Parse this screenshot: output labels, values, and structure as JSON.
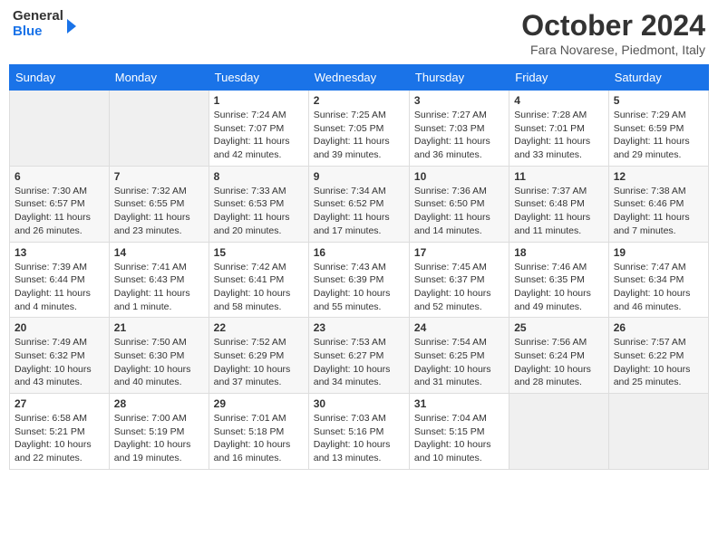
{
  "logo": {
    "line1": "General",
    "line2": "Blue"
  },
  "header": {
    "title": "October 2024",
    "subtitle": "Fara Novarese, Piedmont, Italy"
  },
  "weekdays": [
    "Sunday",
    "Monday",
    "Tuesday",
    "Wednesday",
    "Thursday",
    "Friday",
    "Saturday"
  ],
  "weeks": [
    [
      {
        "day": "",
        "sunrise": "",
        "sunset": "",
        "daylight": ""
      },
      {
        "day": "",
        "sunrise": "",
        "sunset": "",
        "daylight": ""
      },
      {
        "day": "1",
        "sunrise": "Sunrise: 7:24 AM",
        "sunset": "Sunset: 7:07 PM",
        "daylight": "Daylight: 11 hours and 42 minutes."
      },
      {
        "day": "2",
        "sunrise": "Sunrise: 7:25 AM",
        "sunset": "Sunset: 7:05 PM",
        "daylight": "Daylight: 11 hours and 39 minutes."
      },
      {
        "day": "3",
        "sunrise": "Sunrise: 7:27 AM",
        "sunset": "Sunset: 7:03 PM",
        "daylight": "Daylight: 11 hours and 36 minutes."
      },
      {
        "day": "4",
        "sunrise": "Sunrise: 7:28 AM",
        "sunset": "Sunset: 7:01 PM",
        "daylight": "Daylight: 11 hours and 33 minutes."
      },
      {
        "day": "5",
        "sunrise": "Sunrise: 7:29 AM",
        "sunset": "Sunset: 6:59 PM",
        "daylight": "Daylight: 11 hours and 29 minutes."
      }
    ],
    [
      {
        "day": "6",
        "sunrise": "Sunrise: 7:30 AM",
        "sunset": "Sunset: 6:57 PM",
        "daylight": "Daylight: 11 hours and 26 minutes."
      },
      {
        "day": "7",
        "sunrise": "Sunrise: 7:32 AM",
        "sunset": "Sunset: 6:55 PM",
        "daylight": "Daylight: 11 hours and 23 minutes."
      },
      {
        "day": "8",
        "sunrise": "Sunrise: 7:33 AM",
        "sunset": "Sunset: 6:53 PM",
        "daylight": "Daylight: 11 hours and 20 minutes."
      },
      {
        "day": "9",
        "sunrise": "Sunrise: 7:34 AM",
        "sunset": "Sunset: 6:52 PM",
        "daylight": "Daylight: 11 hours and 17 minutes."
      },
      {
        "day": "10",
        "sunrise": "Sunrise: 7:36 AM",
        "sunset": "Sunset: 6:50 PM",
        "daylight": "Daylight: 11 hours and 14 minutes."
      },
      {
        "day": "11",
        "sunrise": "Sunrise: 7:37 AM",
        "sunset": "Sunset: 6:48 PM",
        "daylight": "Daylight: 11 hours and 11 minutes."
      },
      {
        "day": "12",
        "sunrise": "Sunrise: 7:38 AM",
        "sunset": "Sunset: 6:46 PM",
        "daylight": "Daylight: 11 hours and 7 minutes."
      }
    ],
    [
      {
        "day": "13",
        "sunrise": "Sunrise: 7:39 AM",
        "sunset": "Sunset: 6:44 PM",
        "daylight": "Daylight: 11 hours and 4 minutes."
      },
      {
        "day": "14",
        "sunrise": "Sunrise: 7:41 AM",
        "sunset": "Sunset: 6:43 PM",
        "daylight": "Daylight: 11 hours and 1 minute."
      },
      {
        "day": "15",
        "sunrise": "Sunrise: 7:42 AM",
        "sunset": "Sunset: 6:41 PM",
        "daylight": "Daylight: 10 hours and 58 minutes."
      },
      {
        "day": "16",
        "sunrise": "Sunrise: 7:43 AM",
        "sunset": "Sunset: 6:39 PM",
        "daylight": "Daylight: 10 hours and 55 minutes."
      },
      {
        "day": "17",
        "sunrise": "Sunrise: 7:45 AM",
        "sunset": "Sunset: 6:37 PM",
        "daylight": "Daylight: 10 hours and 52 minutes."
      },
      {
        "day": "18",
        "sunrise": "Sunrise: 7:46 AM",
        "sunset": "Sunset: 6:35 PM",
        "daylight": "Daylight: 10 hours and 49 minutes."
      },
      {
        "day": "19",
        "sunrise": "Sunrise: 7:47 AM",
        "sunset": "Sunset: 6:34 PM",
        "daylight": "Daylight: 10 hours and 46 minutes."
      }
    ],
    [
      {
        "day": "20",
        "sunrise": "Sunrise: 7:49 AM",
        "sunset": "Sunset: 6:32 PM",
        "daylight": "Daylight: 10 hours and 43 minutes."
      },
      {
        "day": "21",
        "sunrise": "Sunrise: 7:50 AM",
        "sunset": "Sunset: 6:30 PM",
        "daylight": "Daylight: 10 hours and 40 minutes."
      },
      {
        "day": "22",
        "sunrise": "Sunrise: 7:52 AM",
        "sunset": "Sunset: 6:29 PM",
        "daylight": "Daylight: 10 hours and 37 minutes."
      },
      {
        "day": "23",
        "sunrise": "Sunrise: 7:53 AM",
        "sunset": "Sunset: 6:27 PM",
        "daylight": "Daylight: 10 hours and 34 minutes."
      },
      {
        "day": "24",
        "sunrise": "Sunrise: 7:54 AM",
        "sunset": "Sunset: 6:25 PM",
        "daylight": "Daylight: 10 hours and 31 minutes."
      },
      {
        "day": "25",
        "sunrise": "Sunrise: 7:56 AM",
        "sunset": "Sunset: 6:24 PM",
        "daylight": "Daylight: 10 hours and 28 minutes."
      },
      {
        "day": "26",
        "sunrise": "Sunrise: 7:57 AM",
        "sunset": "Sunset: 6:22 PM",
        "daylight": "Daylight: 10 hours and 25 minutes."
      }
    ],
    [
      {
        "day": "27",
        "sunrise": "Sunrise: 6:58 AM",
        "sunset": "Sunset: 5:21 PM",
        "daylight": "Daylight: 10 hours and 22 minutes."
      },
      {
        "day": "28",
        "sunrise": "Sunrise: 7:00 AM",
        "sunset": "Sunset: 5:19 PM",
        "daylight": "Daylight: 10 hours and 19 minutes."
      },
      {
        "day": "29",
        "sunrise": "Sunrise: 7:01 AM",
        "sunset": "Sunset: 5:18 PM",
        "daylight": "Daylight: 10 hours and 16 minutes."
      },
      {
        "day": "30",
        "sunrise": "Sunrise: 7:03 AM",
        "sunset": "Sunset: 5:16 PM",
        "daylight": "Daylight: 10 hours and 13 minutes."
      },
      {
        "day": "31",
        "sunrise": "Sunrise: 7:04 AM",
        "sunset": "Sunset: 5:15 PM",
        "daylight": "Daylight: 10 hours and 10 minutes."
      },
      {
        "day": "",
        "sunrise": "",
        "sunset": "",
        "daylight": ""
      },
      {
        "day": "",
        "sunrise": "",
        "sunset": "",
        "daylight": ""
      }
    ]
  ]
}
